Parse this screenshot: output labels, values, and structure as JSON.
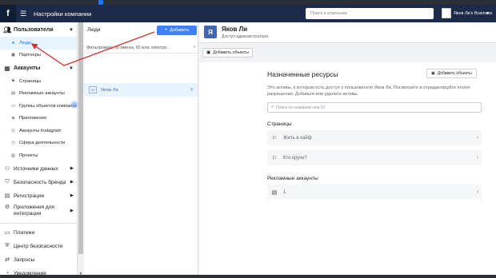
{
  "topbar": {
    "logo": "f",
    "title": "Настройки компании",
    "search_placeholder": "Поиск в компании",
    "business_name": "Яков Ли's Business",
    "caret": "▾"
  },
  "sidebar": {
    "users": {
      "label": "Пользователи",
      "items": [
        {
          "label": "Люди",
          "icon": "person-icon"
        },
        {
          "label": "Партнеры",
          "icon": "briefcase-icon"
        }
      ]
    },
    "accounts": {
      "label": "Аккаунты",
      "items": [
        {
          "label": "Страницы",
          "icon": "flag-icon"
        },
        {
          "label": "Рекламные аккаунты",
          "icon": "ad-account-icon"
        },
        {
          "label": "Группы объектов компании",
          "icon": "folder-icon"
        },
        {
          "label": "Приложения",
          "icon": "app-icon"
        },
        {
          "label": "Аккаунты Instagram",
          "icon": "instagram-icon"
        },
        {
          "label": "Сфера деятельности",
          "icon": "line-of-business-icon"
        },
        {
          "label": "Проекты",
          "icon": "project-icon"
        }
      ]
    },
    "more": [
      {
        "label": "Источники данных",
        "icon": "data-sources-icon",
        "has_arrow": true
      },
      {
        "label": "Безопасность бренда",
        "icon": "shield-icon",
        "has_arrow": true
      },
      {
        "label": "Регистрации",
        "icon": "registration-icon",
        "has_arrow": true
      },
      {
        "label": "Приложения для интеграции",
        "icon": "integration-icon",
        "has_arrow": true
      }
    ],
    "bottom": [
      {
        "label": "Платежи",
        "icon": "payment-icon"
      },
      {
        "label": "Центр безопасности",
        "icon": "security-center-icon"
      },
      {
        "label": "Запросы",
        "icon": "requests-icon"
      },
      {
        "label": "Уведомления",
        "icon": "notifications-icon"
      }
    ]
  },
  "people": {
    "title": "Люди",
    "add_label": "Добавить",
    "filter_placeholder": "Фильтровать по имени, ID или электро...",
    "rows": [
      {
        "name": "Яков Ли",
        "avatar": "ЯЛ"
      }
    ]
  },
  "detail": {
    "avatar_letter": "Я",
    "name": "Яков Ли",
    "role": "Доступ администратора",
    "add_objects_label": "Добавить объекты",
    "card_title": "Назначенные ресурсы",
    "card_add_label": "Добавить объекты",
    "description": "Это активы, к которым есть доступ у пользователя Яков Ли. Посмотрите и отредактируйте его/ее разрешения. Добавьте или удалите активы.",
    "search_placeholder": "Поиск по названию или ID",
    "pages_label": "Страницы",
    "pages": [
      {
        "label": "Жить в кайф"
      },
      {
        "label": "Кто круче?"
      }
    ],
    "ad_accounts_label": "Рекламные аккаунты",
    "ad_accounts": [
      {
        "label": "1"
      }
    ]
  },
  "colors": {
    "topbar": "#1c2b4a",
    "accent": "#4080ff",
    "selected_bg": "#e7f3ff",
    "annotation_arrow": "#d0312d"
  }
}
